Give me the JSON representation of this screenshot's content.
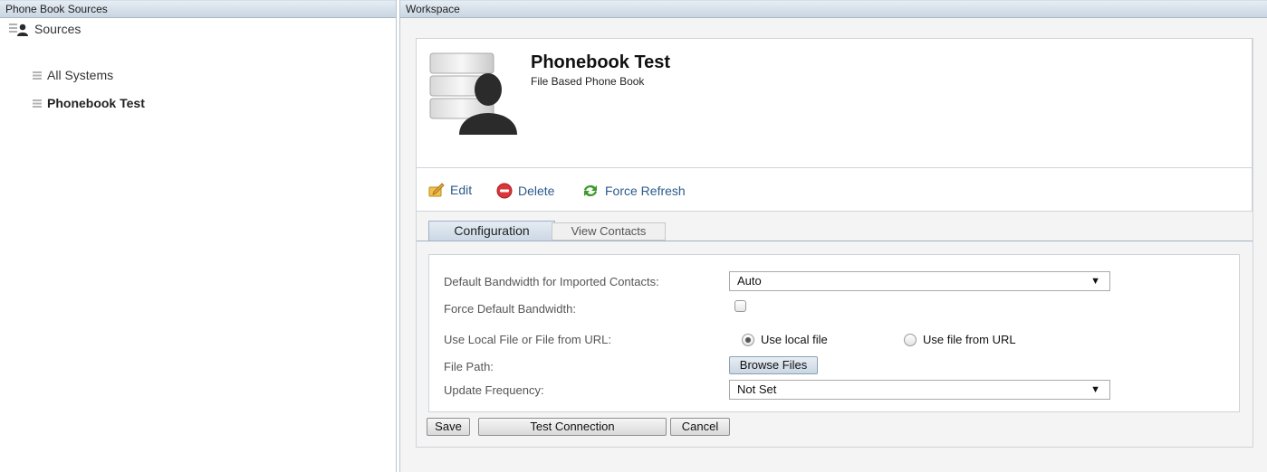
{
  "left_panel": {
    "header": "Phone Book Sources",
    "tree": {
      "root_label": "Sources",
      "children": [
        {
          "label": "All Systems"
        },
        {
          "label": "Phonebook Test"
        }
      ]
    }
  },
  "workspace": {
    "header": "Workspace",
    "title": "Phonebook Test",
    "subtitle": "File Based Phone Book",
    "actions": {
      "edit": "Edit",
      "delete": "Delete",
      "refresh": "Force Refresh"
    },
    "tabs": [
      {
        "label": "Configuration",
        "active": true
      },
      {
        "label": "View Contacts",
        "active": false
      }
    ],
    "form": {
      "bandwidth_label": "Default Bandwidth for Imported Contacts:",
      "bandwidth_value": "Auto",
      "force_label": "Force Default Bandwidth:",
      "force_checked": false,
      "source_label": "Use Local File or File from URL:",
      "source_options": [
        "Use local file",
        "Use file from URL"
      ],
      "source_selected": "Use local file",
      "filepath_label": "File Path:",
      "browse_label": "Browse Files",
      "frequency_label": "Update Frequency:",
      "frequency_value": "Not Set"
    },
    "buttons": {
      "save": "Save",
      "test": "Test Connection",
      "cancel": "Cancel"
    }
  },
  "colors": {
    "header_gradient_top": "#e6edf4",
    "header_gradient_bottom": "#c9d5e1",
    "link": "#2b5a8c",
    "delete_red": "#d9353a",
    "refresh_green": "#3c9a2a"
  },
  "icons": [
    "sources-icon",
    "list-icon",
    "phonebook-user-icon",
    "edit-icon",
    "delete-icon",
    "refresh-icon",
    "dropdown-arrow-icon"
  ]
}
